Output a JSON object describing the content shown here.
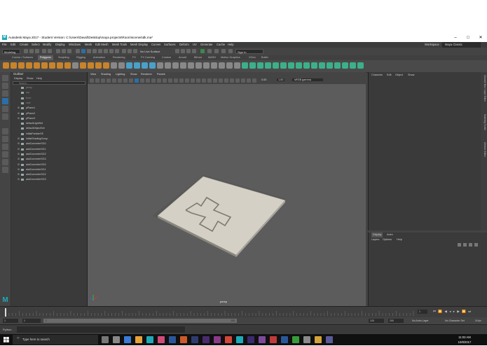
{
  "window": {
    "title": "Autodesk Maya 2017 - Student Version: C:\\Users\\David\\Desktop\\maya projects\\Room\\scenes\\dk.ma*",
    "app_badge": "M"
  },
  "menubar": {
    "items": [
      "File",
      "Edit",
      "Create",
      "Select",
      "Modify",
      "Display",
      "Windows",
      "Mesh",
      "Edit Mesh",
      "Mesh Tools",
      "Mesh Display",
      "Curves",
      "Surfaces",
      "Deform",
      "UV",
      "Generate",
      "Cache",
      "Help"
    ],
    "workspace_label": "Workspace :",
    "workspace_value": "Maya Classic"
  },
  "status_line": {
    "mode": "Modeling",
    "live_surface": "No Live Surface",
    "sign_in": "Sign In"
  },
  "shelf_tabs": {
    "items": [
      "Curves / Surfaces",
      "Polygons",
      "Sculpting",
      "Rigging",
      "Animation",
      "Rendering",
      "FX",
      "FX Caching",
      "Custom",
      "Arnold",
      "Bifrost",
      "MASH",
      "Motion Graphics",
      "XGen",
      "Bullet"
    ],
    "active_index": 1
  },
  "outliner": {
    "title": "Outliner",
    "menu": [
      "Display",
      "Show",
      "Help"
    ],
    "search_placeholder": "Search...",
    "items": [
      "persp",
      "top",
      "front",
      "side",
      "pPlane1",
      "pPlane2",
      "pPlane3",
      "defaultLightSet",
      "defaultObjectSet",
      "initialParticleSE",
      "initialShadingGroup",
      "aiaiConverterSG0",
      "aiaiConverterSG1",
      "aiaiConverterSG2",
      "aiaiConverterSG3",
      "aiaiConverterSG0",
      "aiaiConverterSG1",
      "aiaiConverterSG2",
      "aiaiConverterSG3"
    ]
  },
  "viewport": {
    "menu": [
      "View",
      "Shading",
      "Lighting",
      "Show",
      "Renderer",
      "Panels"
    ],
    "gamma_value_1": "0.00",
    "gamma_value_2": "1.00",
    "color_space": "sRGB gamma",
    "camera_label": "persp",
    "axis_label": "Y"
  },
  "channel_box": {
    "menu": [
      "Channels",
      "Edit",
      "Object",
      "Show"
    ],
    "side_tabs": [
      "Channel Box / Layer Editor",
      "Modeling Toolkit",
      "Attribute Editor"
    ]
  },
  "layer_editor": {
    "tabs": [
      "Display",
      "Anim"
    ],
    "menu": [
      "Layers",
      "Options",
      "Help"
    ]
  },
  "time_slider": {
    "start": "1",
    "end": "120",
    "current": "1",
    "range_start": "1",
    "range_inner_start": "1",
    "range_inner_end": "120",
    "range_end_a": "120",
    "range_end_b": "200",
    "anim_layer": "No Anim Layer",
    "char_set": "No Character Set",
    "fps": "24 fps"
  },
  "command_line": {
    "lang": "Python"
  },
  "taskbar": {
    "search_placeholder": "Type here to search",
    "time": "11:03 AM",
    "date": "10/8/2017"
  },
  "colors": {
    "maya_teal": "#1ea9b8",
    "viewport_bg": "#5c5c5c",
    "plane": "#d4d0c6",
    "plane_edge": "#9b978e"
  }
}
